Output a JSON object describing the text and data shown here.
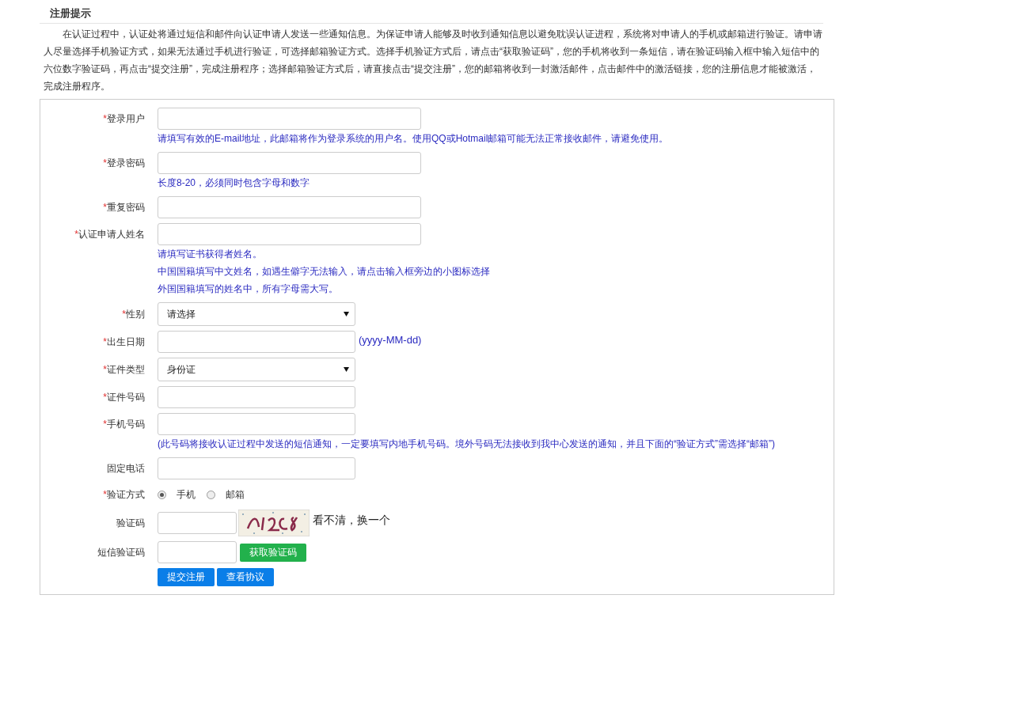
{
  "notice": {
    "title": "注册提示",
    "paragraph": "在认证过程中，认证处将通过短信和邮件向认证申请人发送一些通知信息。为保证申请人能够及时收到通知信息以避免耽误认证进程，系统将对申请人的手机或邮箱进行验证。请申请人尽量选择手机验证方式，如果无法通过手机进行验证，可选择邮箱验证方式。选择手机验证方式后，请点击“获取验证码”，您的手机将收到一条短信，请在验证码输入框中输入短信中的六位数字验证码，再点击“提交注册”，完成注册程序；选择邮箱验证方式后，请直接点击“提交注册”，您的邮箱将收到一封激活邮件，点击邮件中的激活链接，您的注册信息才能被激活，完成注册程序。"
  },
  "form": {
    "fields": [
      {
        "kind": "text",
        "required_mark": "*",
        "label": "登录用户",
        "hints": [
          "请填写有效的E-mail地址，此邮箱将作为登录系统的用户名。使用QQ或Hotmail邮箱可能无法正常接收邮件，请避免使用。"
        ]
      },
      {
        "kind": "text",
        "required_mark": "*",
        "label": "登录密码",
        "hints": [
          "长度8-20，必须同时包含字母和数字"
        ]
      },
      {
        "kind": "text",
        "required_mark": "*",
        "label": "重复密码"
      },
      {
        "kind": "text",
        "required_mark": "*",
        "label": "认证申请人姓名",
        "hints": [
          "请填写证书获得者姓名。",
          "中国国籍填写中文姓名，如遇生僻字无法输入，请点击输入框旁边的小图标选择",
          "外国国籍填写的姓名中，所有字母需大写。"
        ]
      },
      {
        "kind": "select",
        "required_mark": "*",
        "label": "性别",
        "value": "请选择"
      },
      {
        "kind": "medium",
        "required_mark": "*",
        "label": "出生日期",
        "suffix": "(yyyy-MM-dd)"
      },
      {
        "kind": "select",
        "required_mark": "*",
        "label": "证件类型",
        "value": "身份证"
      },
      {
        "kind": "medium",
        "required_mark": "*",
        "label": "证件号码"
      },
      {
        "kind": "medium",
        "required_mark": "*",
        "label": "手机号码",
        "hints": [
          "(此号码将接收认证过程中发送的短信通知，一定要填写内地手机号码。境外号码无法接收到我中心发送的通知，并且下面的“验证方式”需选择“邮箱”)"
        ]
      },
      {
        "kind": "medium",
        "label": "固定电话"
      },
      {
        "kind": "radio",
        "required_mark": "*",
        "label": "验证方式",
        "options": [
          {
            "label": "手机",
            "selected": true
          },
          {
            "label": "邮箱",
            "selected": false
          }
        ]
      },
      {
        "kind": "captcha",
        "label": "验证码",
        "link": "看不清，换一个"
      },
      {
        "kind": "sms",
        "label": "短信验证码",
        "button": "获取验证码"
      }
    ],
    "buttons": [
      "提交注册",
      "查看协议"
    ]
  }
}
